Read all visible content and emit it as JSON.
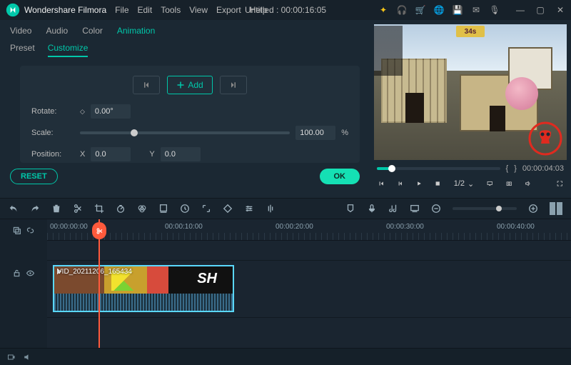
{
  "app": {
    "name": "Wondershare Filmora"
  },
  "menu": {
    "file": "File",
    "edit": "Edit",
    "tools": "Tools",
    "view": "View",
    "export": "Export",
    "help": "Help"
  },
  "document": {
    "title": "Untitled : 00:00:16:05"
  },
  "prop_tabs": {
    "video": "Video",
    "audio": "Audio",
    "color": "Color",
    "animation": "Animation"
  },
  "sub_tabs": {
    "preset": "Preset",
    "customize": "Customize"
  },
  "anim": {
    "add_label": "Add",
    "rotate": {
      "label": "Rotate:",
      "value": "0.00°"
    },
    "scale": {
      "label": "Scale:",
      "value": "100.00",
      "unit": "%"
    },
    "position": {
      "label": "Position:",
      "x_label": "X",
      "x": "0.0",
      "y_label": "Y",
      "y": "0.0"
    }
  },
  "buttons": {
    "reset": "RESET",
    "ok": "OK"
  },
  "preview": {
    "hud_timer": "34s",
    "timecode": "00:00:04:03",
    "rate": "1/2"
  },
  "timeline": {
    "ruler": [
      "00:00:00:00",
      "00:00:10:00",
      "00:00:20:00",
      "00:00:30:00",
      "00:00:40:00"
    ],
    "clip_label": "VID_20211206_165434"
  }
}
